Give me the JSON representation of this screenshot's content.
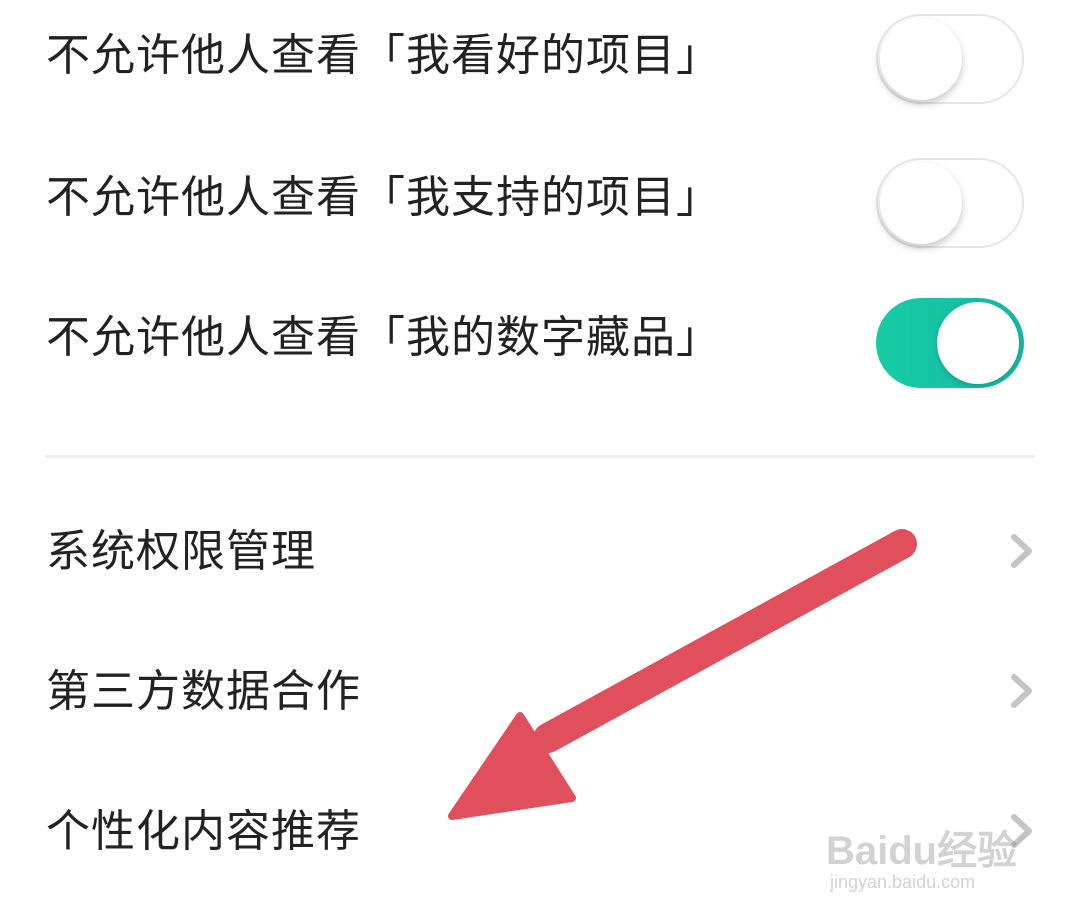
{
  "privacy_toggles": [
    {
      "label": "不允许他人查看「我看好的项目」",
      "state": "off"
    },
    {
      "label": "不允许他人查看「我支持的项目」",
      "state": "off"
    },
    {
      "label": "不允许他人查看「我的数字藏品」",
      "state": "on"
    }
  ],
  "menu_items": [
    {
      "label": "系统权限管理",
      "icon": "chevron-right-icon"
    },
    {
      "label": "第三方数据合作",
      "icon": "chevron-right-icon"
    },
    {
      "label": "个性化内容推荐",
      "icon": "chevron-right-icon"
    }
  ],
  "colors": {
    "toggle_on": "#16cca3",
    "annotation_arrow": "#e0505c",
    "chevron": "#c4c4c4"
  },
  "watermark": {
    "logo_text": "Baidu经验",
    "url": "jingyan.baidu.com"
  }
}
